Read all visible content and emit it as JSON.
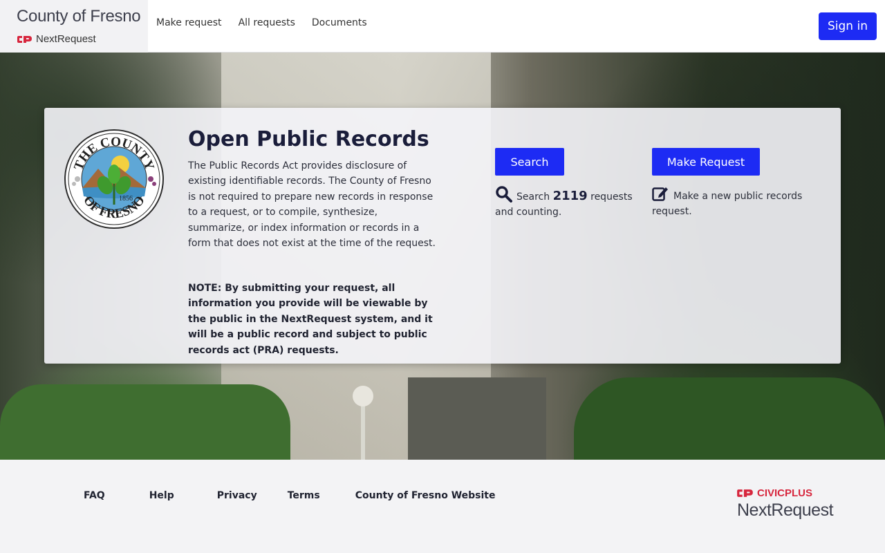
{
  "header": {
    "org_title": "County of Fresno",
    "brand_sub": "NextRequest",
    "nav": [
      "Make request",
      "All requests",
      "Documents"
    ],
    "signin_label": "Sign in",
    "accent": "#1d2bf4"
  },
  "hero": {
    "title": "Open Public Records",
    "description": "The Public Records Act provides disclosure of existing identifiable records. The County of Fresno is not required to prepare new records in response to a request, or to compile, synthesize, summarize, or index information or records in a form that does not exist at the time of the request.",
    "note": "NOTE: By submitting your request, all information you provide will be viewable by the public in the NextRequest system, and it will be a public record and subject to public records act (PRA) requests.",
    "seal": {
      "top": "THE COUNTY",
      "bottom": "OF FRESNO",
      "year": "1856"
    },
    "search": {
      "button": "Search",
      "prefix": "Search",
      "count": "2119",
      "suffix": "requests and counting.",
      "icon": "search-icon"
    },
    "make": {
      "button": "Make Request",
      "text": "Make a new public records request.",
      "icon": "edit-icon"
    }
  },
  "footer": {
    "links": [
      "FAQ",
      "Help",
      "Privacy",
      "Terms",
      "County of Fresno Website"
    ],
    "logo_top": "CIVICPLUS",
    "logo_bottom": "NextRequest",
    "logo_color": "#d7263d"
  }
}
